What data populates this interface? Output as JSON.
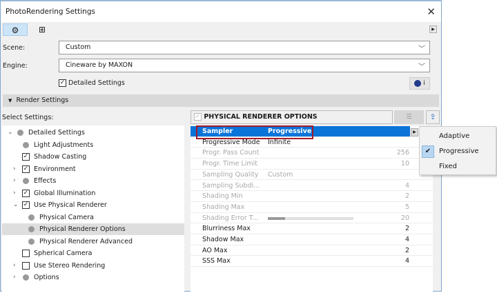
{
  "window": {
    "title": "PhotoRendering Settings"
  },
  "scene": {
    "label": "Scene:",
    "value": "Custom"
  },
  "engine": {
    "label": "Engine:",
    "value": "Cineware by MAXON",
    "info": "i"
  },
  "detailed_settings": {
    "label": "Detailed Settings",
    "checked": true
  },
  "render_settings": {
    "label": "Render Settings"
  },
  "select_settings": {
    "label": "Select Settings:"
  },
  "tree": [
    {
      "label": "Detailed Settings",
      "type": "dot",
      "arrow": "down",
      "level": 0
    },
    {
      "label": "Light Adjustments",
      "type": "dot",
      "arrow": "",
      "level": 1
    },
    {
      "label": "Shadow Casting",
      "type": "check",
      "checked": true,
      "arrow": "",
      "level": 1
    },
    {
      "label": "Environment",
      "type": "check",
      "checked": true,
      "arrow": "right",
      "level": 1
    },
    {
      "label": "Effects",
      "type": "dot",
      "arrow": "right",
      "level": 1
    },
    {
      "label": "Global Illumination",
      "type": "check",
      "checked": true,
      "arrow": "right",
      "level": 1
    },
    {
      "label": "Use Physical Renderer",
      "type": "check",
      "checked": true,
      "arrow": "down",
      "level": 1
    },
    {
      "label": "Physical Camera",
      "type": "dot",
      "arrow": "",
      "level": 2
    },
    {
      "label": "Physical Renderer Options",
      "type": "dot",
      "arrow": "",
      "level": 2,
      "selected": true
    },
    {
      "label": "Physical Renderer Advanced",
      "type": "dot",
      "arrow": "",
      "level": 2
    },
    {
      "label": "Spherical Camera",
      "type": "check",
      "checked": false,
      "arrow": "",
      "level": 1
    },
    {
      "label": "Use Stereo Rendering",
      "type": "check",
      "checked": false,
      "arrow": "right",
      "level": 1
    },
    {
      "label": "Options",
      "type": "dot",
      "arrow": "right",
      "level": 1
    }
  ],
  "panel": {
    "title": "PHYSICAL RENDERER OPTIONS"
  },
  "rows": [
    {
      "name": "Sampler",
      "value": "Progressive",
      "num": "",
      "state": "hl"
    },
    {
      "name": "Progressive Mode",
      "value": "Infinite",
      "num": "",
      "state": ""
    },
    {
      "name": "Progr. Pass Count",
      "value": "",
      "num": "256",
      "state": "dim"
    },
    {
      "name": "Progr. Time Limit",
      "value": "",
      "num": "10",
      "state": "dim"
    },
    {
      "name": "Sampling Quality",
      "value": "Custom",
      "num": "",
      "state": "dim"
    },
    {
      "name": "Sampling Subdi...",
      "value": "",
      "num": "4",
      "state": "dim"
    },
    {
      "name": "Shading Min",
      "value": "",
      "num": "2",
      "state": "dim"
    },
    {
      "name": "Shading Max",
      "value": "",
      "num": "5",
      "state": "dim"
    },
    {
      "name": "Shading Error T...",
      "value": "",
      "num": "20",
      "state": "dim",
      "slider": 0.2
    },
    {
      "name": "Blurriness Max",
      "value": "",
      "num": "2",
      "state": ""
    },
    {
      "name": "Shadow Max",
      "value": "",
      "num": "4",
      "state": ""
    },
    {
      "name": "AO Max",
      "value": "",
      "num": "2",
      "state": ""
    },
    {
      "name": "SSS Max",
      "value": "",
      "num": "4",
      "state": ""
    }
  ],
  "sampler_menu": [
    {
      "label": "Adaptive",
      "checked": false
    },
    {
      "label": "Progressive",
      "checked": true
    },
    {
      "label": "Fixed",
      "checked": false
    }
  ],
  "colors": {
    "highlight": "#0a74d8",
    "annotation": "#a3192a"
  }
}
